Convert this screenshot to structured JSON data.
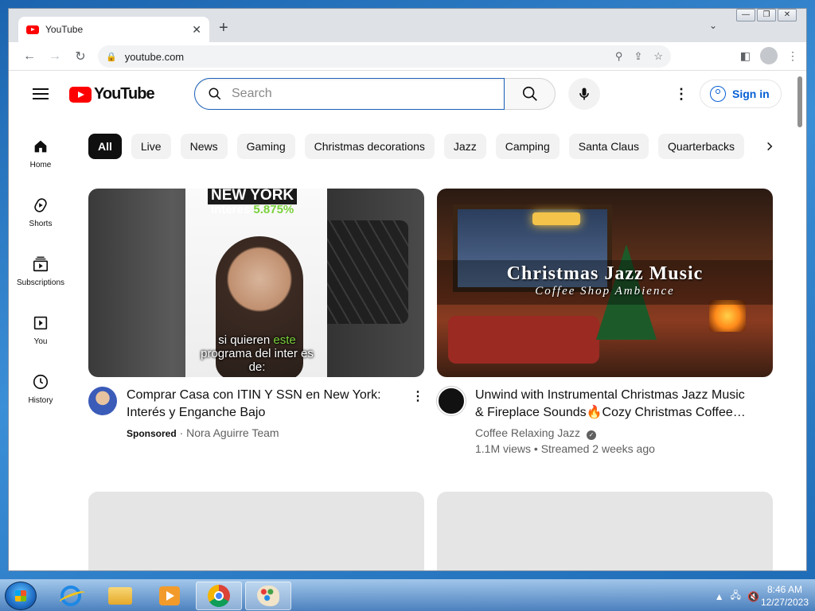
{
  "browser": {
    "tab_title": "YouTube",
    "tab_close": "✕",
    "new_tab": "+",
    "url": "youtube.com",
    "window_controls": [
      "—",
      "❐",
      "✕"
    ]
  },
  "youtube": {
    "logo_text": "YouTube",
    "search_placeholder": "Search",
    "sign_in": "Sign in",
    "sidebar": [
      {
        "label": "Home",
        "icon": "home-icon"
      },
      {
        "label": "Shorts",
        "icon": "shorts-icon"
      },
      {
        "label": "Subscriptions",
        "icon": "subscriptions-icon"
      },
      {
        "label": "You",
        "icon": "you-icon"
      },
      {
        "label": "History",
        "icon": "history-icon"
      }
    ],
    "chips": [
      "All",
      "Live",
      "News",
      "Gaming",
      "Christmas decorations",
      "Jazz",
      "Camping",
      "Santa Claus",
      "Quarterbacks"
    ],
    "videos": [
      {
        "title": "Comprar Casa con ITIN Y SSN en New York: Interés y Enganche Bajo",
        "sponsored": "Sponsored",
        "channel": "Nora Aguirre Team",
        "thumb_headline": "NEW YORK",
        "thumb_rate_label": "Interés",
        "thumb_rate_value": "5.875%",
        "thumb_caption_1": "si quieren",
        "thumb_caption_hl": "este",
        "thumb_caption_2": "programa del inter es de:"
      },
      {
        "title": "Unwind with Instrumental Christmas Jazz Music & Fireplace Sounds🔥Cozy Christmas Coffee…",
        "channel": "Coffee Relaxing Jazz",
        "stats": "1.1M views • Streamed 2 weeks ago",
        "thumb_big": "Christmas Jazz Music",
        "thumb_small": "Coffee Shop Ambience"
      }
    ]
  },
  "taskbar": {
    "time": "8:46 AM",
    "date": "12/27/2023"
  }
}
